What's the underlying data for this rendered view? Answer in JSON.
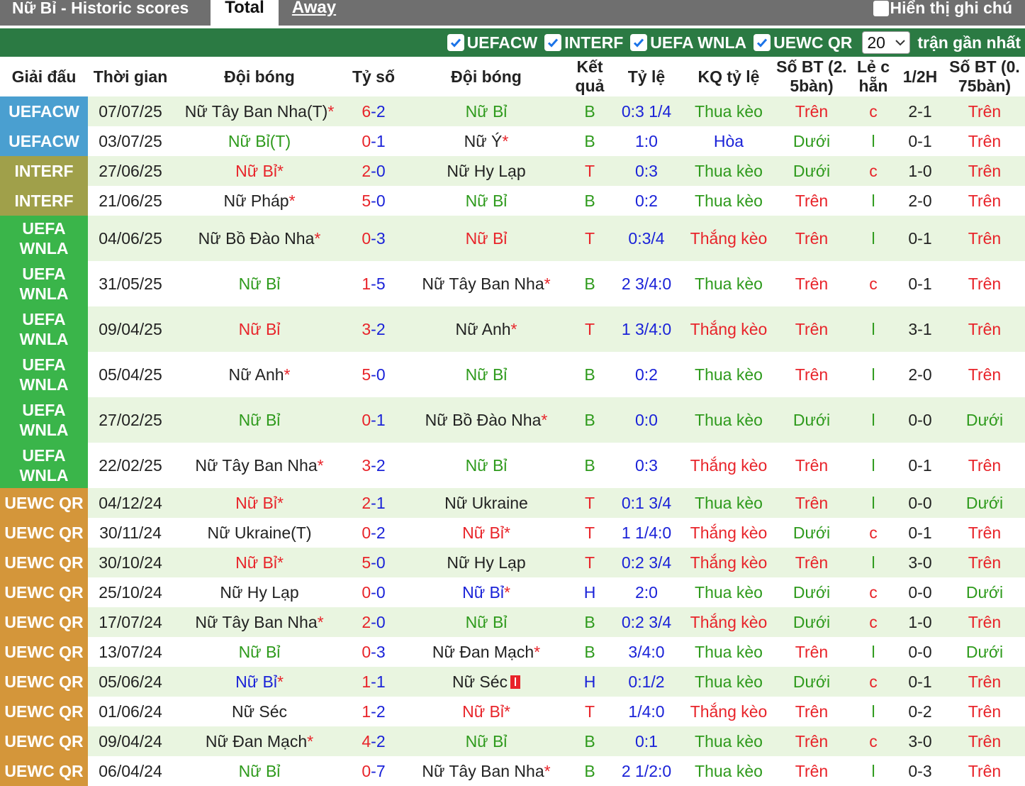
{
  "topbar": {
    "title": "Nữ Bỉ - Historic scores",
    "tab_total": "Total",
    "tab_away": "Away",
    "note_label": "Hiển thị ghi chú"
  },
  "filters": {
    "items": [
      "UEFACW",
      "INTERF",
      "UEFA WNLA",
      "UEWC QR"
    ],
    "count_value": "20",
    "count_suffix": "trận gần nhất"
  },
  "headers": {
    "league": "Giải đấu",
    "time": "Thời gian",
    "home": "Đội bóng",
    "score": "Tỷ số",
    "away": "Đội bóng",
    "result": "Kết quả",
    "odds": "Tỷ lệ",
    "odds_result": "KQ tỷ lệ",
    "goals25": "Số BT (2. 5bàn)",
    "oddeven": "Lẻ c hẵn",
    "half": "1/2H",
    "goals075": "Số BT (0. 75bàn)"
  },
  "colors": {
    "UEFACW": "#4a9fd0",
    "INTERF": "#a0a04a",
    "UEFA WNLA": "#3ab54a",
    "UEWC QR": "#d4963a",
    "row_light": "#e9f5e0",
    "row_white": "#ffffff"
  },
  "rows": [
    {
      "league": "UEFACW",
      "date": "07/07/25",
      "home": "Nữ Tây Ban Nha(T)",
      "home_star": true,
      "home_color": "dark",
      "s1": "6",
      "s2": "2",
      "away": "Nữ Bỉ",
      "away_star": false,
      "away_color": "green",
      "result": "B",
      "odds": "0:3 1/4",
      "odds_result": "Thua kèo",
      "goals25": "Trên",
      "oddeven": "c",
      "half": "2-1",
      "goals075": "Trên"
    },
    {
      "league": "UEFACW",
      "date": "03/07/25",
      "home": "Nữ Bỉ(T)",
      "home_star": false,
      "home_color": "green",
      "s1": "0",
      "s2": "1",
      "away": "Nữ Ý",
      "away_star": true,
      "away_color": "dark",
      "result": "B",
      "odds": "1:0",
      "odds_result": "Hòa",
      "goals25": "Dưới",
      "oddeven": "l",
      "half": "0-1",
      "goals075": "Trên"
    },
    {
      "league": "INTERF",
      "date": "27/06/25",
      "home": "Nữ Bỉ",
      "home_star": true,
      "home_color": "red",
      "s1": "2",
      "s2": "0",
      "away": "Nữ Hy Lạp",
      "away_star": false,
      "away_color": "dark",
      "result": "T",
      "odds": "0:3",
      "odds_result": "Thua kèo",
      "goals25": "Dưới",
      "oddeven": "c",
      "half": "1-0",
      "goals075": "Trên"
    },
    {
      "league": "INTERF",
      "date": "21/06/25",
      "home": "Nữ Pháp",
      "home_star": true,
      "home_color": "dark",
      "s1": "5",
      "s2": "0",
      "away": "Nữ Bỉ",
      "away_star": false,
      "away_color": "green",
      "result": "B",
      "odds": "0:2",
      "odds_result": "Thua kèo",
      "goals25": "Trên",
      "oddeven": "l",
      "half": "2-0",
      "goals075": "Trên"
    },
    {
      "league": "UEFA WNLA",
      "date": "04/06/25",
      "home": "Nữ Bồ Đào Nha",
      "home_star": true,
      "home_color": "dark",
      "s1": "0",
      "s2": "3",
      "away": "Nữ Bỉ",
      "away_star": false,
      "away_color": "red",
      "result": "T",
      "odds": "0:3/4",
      "odds_result": "Thắng kèo",
      "goals25": "Trên",
      "oddeven": "l",
      "half": "0-1",
      "goals075": "Trên"
    },
    {
      "league": "UEFA WNLA",
      "date": "31/05/25",
      "home": "Nữ Bỉ",
      "home_star": false,
      "home_color": "green",
      "s1": "1",
      "s2": "5",
      "away": "Nữ Tây Ban Nha",
      "away_star": true,
      "away_color": "dark",
      "result": "B",
      "odds": "2 3/4:0",
      "odds_result": "Thua kèo",
      "goals25": "Trên",
      "oddeven": "c",
      "half": "0-1",
      "goals075": "Trên"
    },
    {
      "league": "UEFA WNLA",
      "date": "09/04/25",
      "home": "Nữ Bỉ",
      "home_star": false,
      "home_color": "red",
      "s1": "3",
      "s2": "2",
      "away": "Nữ Anh",
      "away_star": true,
      "away_color": "dark",
      "result": "T",
      "odds": "1 3/4:0",
      "odds_result": "Thắng kèo",
      "goals25": "Trên",
      "oddeven": "l",
      "half": "3-1",
      "goals075": "Trên"
    },
    {
      "league": "UEFA WNLA",
      "date": "05/04/25",
      "home": "Nữ Anh",
      "home_star": true,
      "home_color": "dark",
      "s1": "5",
      "s2": "0",
      "away": "Nữ Bỉ",
      "away_star": false,
      "away_color": "green",
      "result": "B",
      "odds": "0:2",
      "odds_result": "Thua kèo",
      "goals25": "Trên",
      "oddeven": "l",
      "half": "2-0",
      "goals075": "Trên"
    },
    {
      "league": "UEFA WNLA",
      "date": "27/02/25",
      "home": "Nữ Bỉ",
      "home_star": false,
      "home_color": "green",
      "s1": "0",
      "s2": "1",
      "away": "Nữ Bồ Đào Nha",
      "away_star": true,
      "away_color": "dark",
      "result": "B",
      "odds": "0:0",
      "odds_result": "Thua kèo",
      "goals25": "Dưới",
      "oddeven": "l",
      "half": "0-0",
      "goals075": "Dưới"
    },
    {
      "league": "UEFA WNLA",
      "date": "22/02/25",
      "home": "Nữ Tây Ban Nha",
      "home_star": true,
      "home_color": "dark",
      "s1": "3",
      "s2": "2",
      "away": "Nữ Bỉ",
      "away_star": false,
      "away_color": "green",
      "result": "B",
      "odds": "0:3",
      "odds_result": "Thắng kèo",
      "goals25": "Trên",
      "oddeven": "l",
      "half": "0-1",
      "goals075": "Trên"
    },
    {
      "league": "UEWC QR",
      "date": "04/12/24",
      "home": "Nữ Bỉ",
      "home_star": true,
      "home_color": "red",
      "s1": "2",
      "s2": "1",
      "away": "Nữ Ukraine",
      "away_star": false,
      "away_color": "dark",
      "result": "T",
      "odds": "0:1 3/4",
      "odds_result": "Thua kèo",
      "goals25": "Trên",
      "oddeven": "l",
      "half": "0-0",
      "goals075": "Dưới"
    },
    {
      "league": "UEWC QR",
      "date": "30/11/24",
      "home": "Nữ Ukraine(T)",
      "home_star": false,
      "home_color": "dark",
      "s1": "0",
      "s2": "2",
      "away": "Nữ Bỉ",
      "away_star": true,
      "away_color": "red",
      "result": "T",
      "odds": "1 1/4:0",
      "odds_result": "Thắng kèo",
      "goals25": "Dưới",
      "oddeven": "c",
      "half": "0-1",
      "goals075": "Trên"
    },
    {
      "league": "UEWC QR",
      "date": "30/10/24",
      "home": "Nữ Bỉ",
      "home_star": true,
      "home_color": "red",
      "s1": "5",
      "s2": "0",
      "away": "Nữ Hy Lạp",
      "away_star": false,
      "away_color": "dark",
      "result": "T",
      "odds": "0:2 3/4",
      "odds_result": "Thắng kèo",
      "goals25": "Trên",
      "oddeven": "l",
      "half": "3-0",
      "goals075": "Trên"
    },
    {
      "league": "UEWC QR",
      "date": "25/10/24",
      "home": "Nữ Hy Lạp",
      "home_star": false,
      "home_color": "dark",
      "s1": "0",
      "s2": "0",
      "away": "Nữ Bỉ",
      "away_star": true,
      "away_color": "blue",
      "result": "H",
      "odds": "2:0",
      "odds_result": "Thua kèo",
      "goals25": "Dưới",
      "oddeven": "c",
      "half": "0-0",
      "goals075": "Dưới"
    },
    {
      "league": "UEWC QR",
      "date": "17/07/24",
      "home": "Nữ Tây Ban Nha",
      "home_star": true,
      "home_color": "dark",
      "s1": "2",
      "s2": "0",
      "away": "Nữ Bỉ",
      "away_star": false,
      "away_color": "green",
      "result": "B",
      "odds": "0:2 3/4",
      "odds_result": "Thắng kèo",
      "goals25": "Dưới",
      "oddeven": "c",
      "half": "1-0",
      "goals075": "Trên"
    },
    {
      "league": "UEWC QR",
      "date": "13/07/24",
      "home": "Nữ Bỉ",
      "home_star": false,
      "home_color": "green",
      "s1": "0",
      "s2": "3",
      "away": "Nữ Đan Mạch",
      "away_star": true,
      "away_color": "dark",
      "result": "B",
      "odds": "3/4:0",
      "odds_result": "Thua kèo",
      "goals25": "Trên",
      "oddeven": "l",
      "half": "0-0",
      "goals075": "Dưới"
    },
    {
      "league": "UEWC QR",
      "date": "05/06/24",
      "home": "Nữ Bỉ",
      "home_star": true,
      "home_color": "blue",
      "s1": "1",
      "s2": "1",
      "away": "Nữ Séc",
      "away_star": false,
      "away_color": "dark",
      "away_redcard": true,
      "result": "H",
      "odds": "0:1/2",
      "odds_result": "Thua kèo",
      "goals25": "Dưới",
      "oddeven": "c",
      "half": "0-1",
      "goals075": "Trên"
    },
    {
      "league": "UEWC QR",
      "date": "01/06/24",
      "home": "Nữ Séc",
      "home_star": false,
      "home_color": "dark",
      "s1": "1",
      "s2": "2",
      "away": "Nữ Bỉ",
      "away_star": true,
      "away_color": "red",
      "result": "T",
      "odds": "1/4:0",
      "odds_result": "Thắng kèo",
      "goals25": "Trên",
      "oddeven": "l",
      "half": "0-2",
      "goals075": "Trên"
    },
    {
      "league": "UEWC QR",
      "date": "09/04/24",
      "home": "Nữ Đan Mạch",
      "home_star": true,
      "home_color": "dark",
      "s1": "4",
      "s2": "2",
      "away": "Nữ Bỉ",
      "away_star": false,
      "away_color": "green",
      "result": "B",
      "odds": "0:1",
      "odds_result": "Thua kèo",
      "goals25": "Trên",
      "oddeven": "c",
      "half": "3-0",
      "goals075": "Trên"
    },
    {
      "league": "UEWC QR",
      "date": "06/04/24",
      "home": "Nữ Bỉ",
      "home_star": false,
      "home_color": "green",
      "s1": "0",
      "s2": "7",
      "away": "Nữ Tây Ban Nha",
      "away_star": true,
      "away_color": "dark",
      "result": "B",
      "odds": "2 1/2:0",
      "odds_result": "Thua kèo",
      "goals25": "Trên",
      "oddeven": "l",
      "half": "0-3",
      "goals075": "Trên"
    }
  ]
}
